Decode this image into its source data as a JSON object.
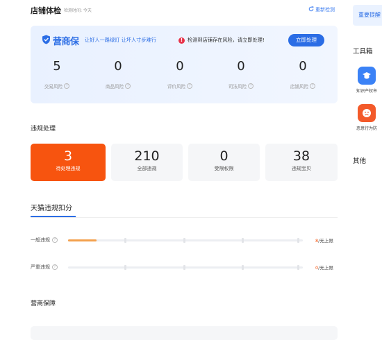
{
  "header": {
    "title": "店铺体检",
    "subtitle": "检测时间: 今天",
    "refresh_icon": "refresh-icon",
    "refresh_label": "重新检测"
  },
  "risk_card": {
    "brand_name": "营商保",
    "brand_icon": "shield-check-icon",
    "slogan": "让好人一路绿灯 让坏人寸步难行",
    "warning_icon": "alert-icon",
    "warning_text": "检测到店铺存在风险，请立即处理!",
    "action_label": "立即处理",
    "stats": [
      {
        "value": "5",
        "label": "交易风险"
      },
      {
        "value": "0",
        "label": "商品风险"
      },
      {
        "value": "0",
        "label": "评价风险"
      },
      {
        "value": "0",
        "label": "司法风险"
      },
      {
        "value": "0",
        "label": "店铺风险"
      }
    ]
  },
  "violation": {
    "title": "违规处理",
    "cards": [
      {
        "value": "3",
        "label": "待处理违规",
        "active": true
      },
      {
        "value": "210",
        "label": "全部违规",
        "active": false
      },
      {
        "value": "0",
        "label": "受限权限",
        "active": false
      },
      {
        "value": "38",
        "label": "违规宝贝",
        "active": false
      }
    ]
  },
  "tmall": {
    "tab_title": "天猫违规扣分",
    "rows": [
      {
        "label": "一般违规",
        "current": "8",
        "limit": "/无上限",
        "progress_fraction": 0.12
      },
      {
        "label": "严重违规",
        "current": "0",
        "limit": "/无上限",
        "progress_fraction": 0
      }
    ]
  },
  "guarantee": {
    "title": "营商保障"
  },
  "sidebar": {
    "top_button": "重要提醒",
    "toolbox_title": "工具箱",
    "tools": [
      {
        "label": "知识产权市",
        "icon": "graduation-cap-icon",
        "color": "#3b82f6"
      },
      {
        "label": "恶意行为防",
        "icon": "sad-face-icon",
        "color": "#f35a2a"
      }
    ],
    "other_title": "其他"
  },
  "colors": {
    "accent": "#2b6de5",
    "danger": "#f7540f",
    "warning": "#e8334a"
  }
}
